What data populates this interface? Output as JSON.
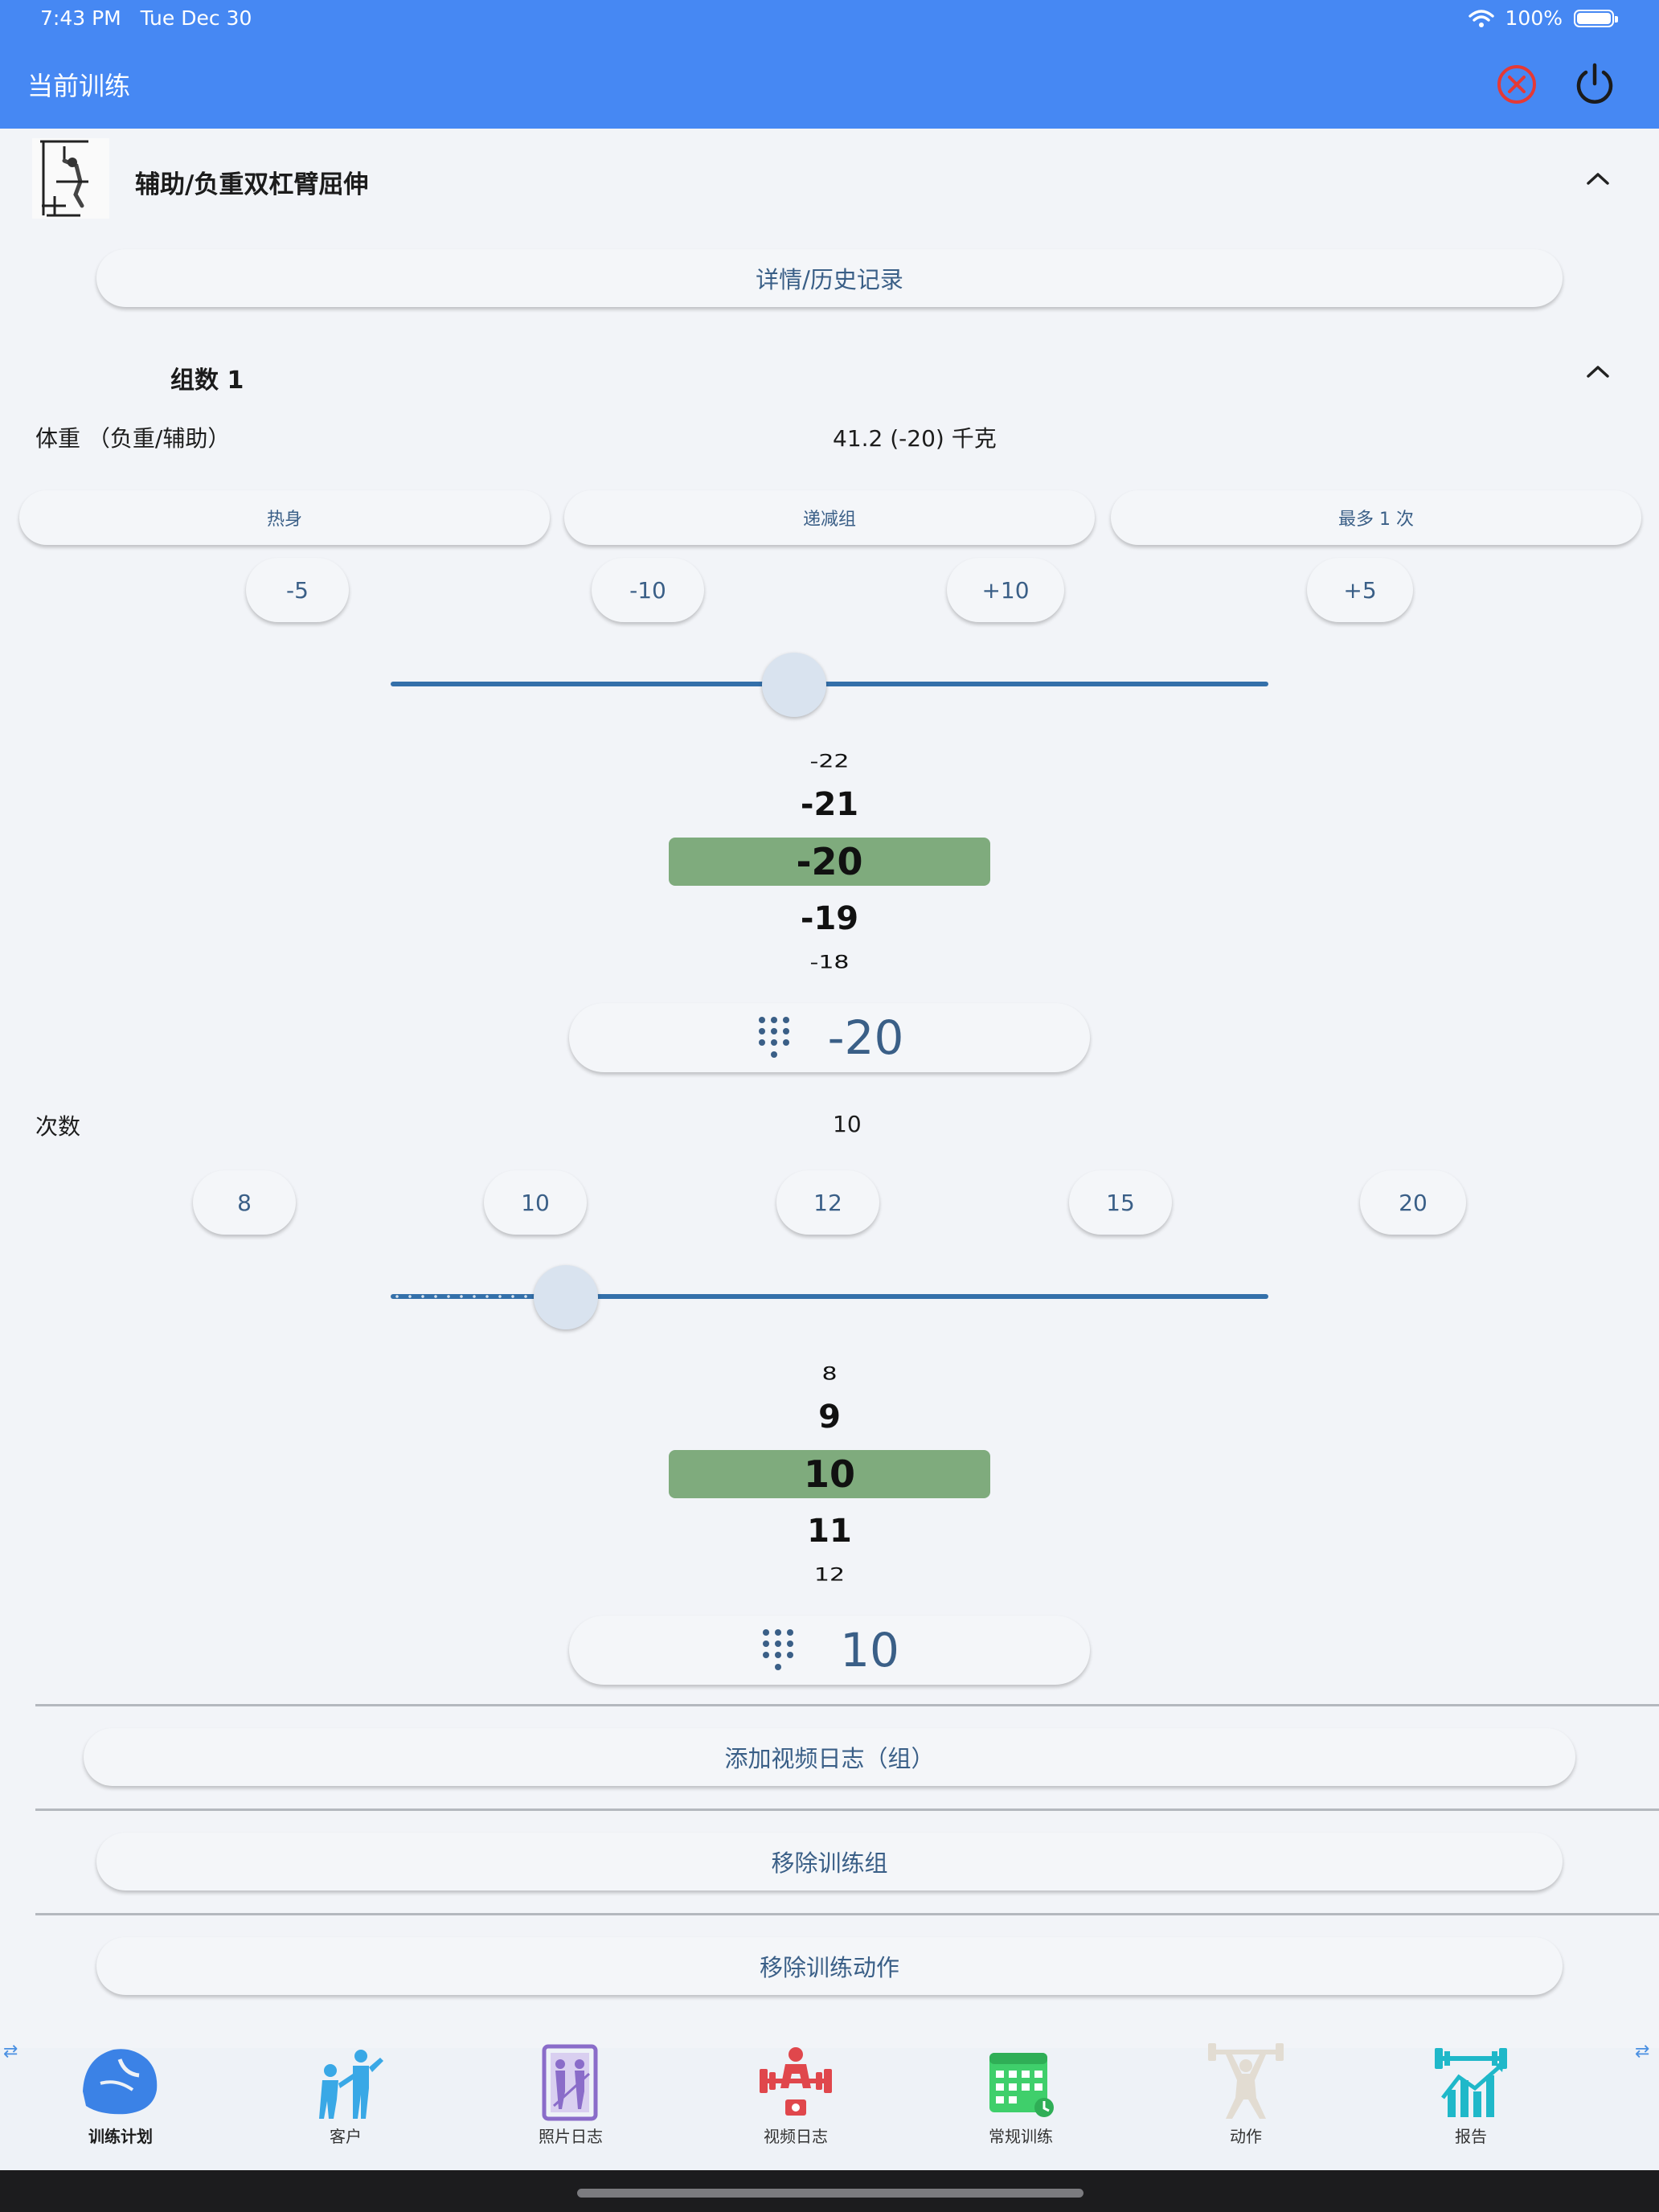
{
  "status_bar": {
    "time": "7:43 PM",
    "date": "Tue Dec 30",
    "battery": "100%"
  },
  "header": {
    "title": "当前训练"
  },
  "exercise": {
    "name": "辅助/负重双杠臂屈伸",
    "details_button": "详情/历史记录"
  },
  "set": {
    "title": "组数 1",
    "weight_label": "体重 （负重/辅助）",
    "weight_value": "41.2 (-20) 千克",
    "type_buttons": [
      "热身",
      "递减组",
      "最多 1 次"
    ],
    "weight_adjust": [
      "-5",
      "-10",
      "+10",
      "+5"
    ],
    "weight_slider_fraction": 0.46,
    "weight_wheel": [
      "-22",
      "-21",
      "-20",
      "-19",
      "-18"
    ],
    "weight_input": "-20",
    "reps_label": "次数",
    "reps_value": "10",
    "reps_presets": [
      "8",
      "10",
      "12",
      "15",
      "20"
    ],
    "reps_slider_fraction": 0.2,
    "reps_wheel": [
      "8",
      "9",
      "10",
      "11",
      "12"
    ],
    "reps_input": "10"
  },
  "actions": {
    "add_video": "添加视频日志（组）",
    "remove_set": "移除训练组",
    "remove_exercise": "移除训练动作"
  },
  "nav": {
    "items": [
      {
        "label": "训练计划",
        "icon": "flexed-bicep-icon",
        "active": true
      },
      {
        "label": "客户",
        "icon": "clients-icon",
        "active": false
      },
      {
        "label": "照片日志",
        "icon": "photo-log-icon",
        "active": false
      },
      {
        "label": "视频日志",
        "icon": "video-log-icon",
        "active": false
      },
      {
        "label": "常规训练",
        "icon": "calendar-icon",
        "active": false
      },
      {
        "label": "动作",
        "icon": "weightlifter-icon",
        "active": false
      },
      {
        "label": "报告",
        "icon": "report-chart-icon",
        "active": false
      }
    ]
  },
  "colors": {
    "primary": "#4688f3",
    "accent_text": "#3a5f87",
    "slider": "#3470aa",
    "wheel_selected": "#7fab7d",
    "cancel": "#e53935"
  }
}
